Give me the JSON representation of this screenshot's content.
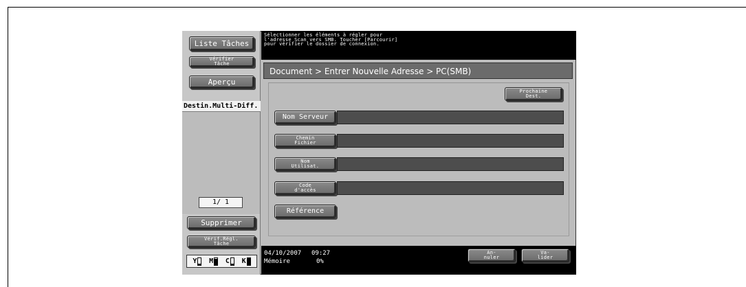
{
  "sidebar": {
    "liste_taches": "Liste Tâches",
    "verifier_tache": "Vérifier\nTâche",
    "apercu": "Aperçu",
    "destin_multi": "Destin.Multi-Diff.",
    "page_indicator": "1/ 1",
    "supprimer": "Supprimer",
    "verif_regl_tache": "Vérif.Régl.\nTâche",
    "toner": [
      {
        "letter": "Y",
        "level": 0.15
      },
      {
        "letter": "M",
        "level": 0.9
      },
      {
        "letter": "C",
        "level": 0.15
      },
      {
        "letter": "K",
        "level": 0.95
      }
    ]
  },
  "message": "Sélectionner les éléments à régler pour\nl'adresse Scan vers SMB. Toucher [Parcourir]\npour vérifier le dossier de connexion.",
  "breadcrumb": "Document > Entrer Nouvelle Adresse > PC(SMB)",
  "buttons": {
    "prochaine_dest": "Prochaine\nDest.",
    "annuler": "An-\nnuler",
    "valider": "Va-\nlider"
  },
  "fields": [
    {
      "label": "Nom Serveur",
      "value": ""
    },
    {
      "label": "Chemin\nFichier",
      "value": ""
    },
    {
      "label": "Nom\nUtilisat.",
      "value": ""
    },
    {
      "label": "Code\nd'accès",
      "value": ""
    }
  ],
  "reference_button": "Référence",
  "status": {
    "date": "04/10/2007",
    "time": "09:27",
    "memory_label": "Mémoire",
    "memory_value": "0%"
  }
}
